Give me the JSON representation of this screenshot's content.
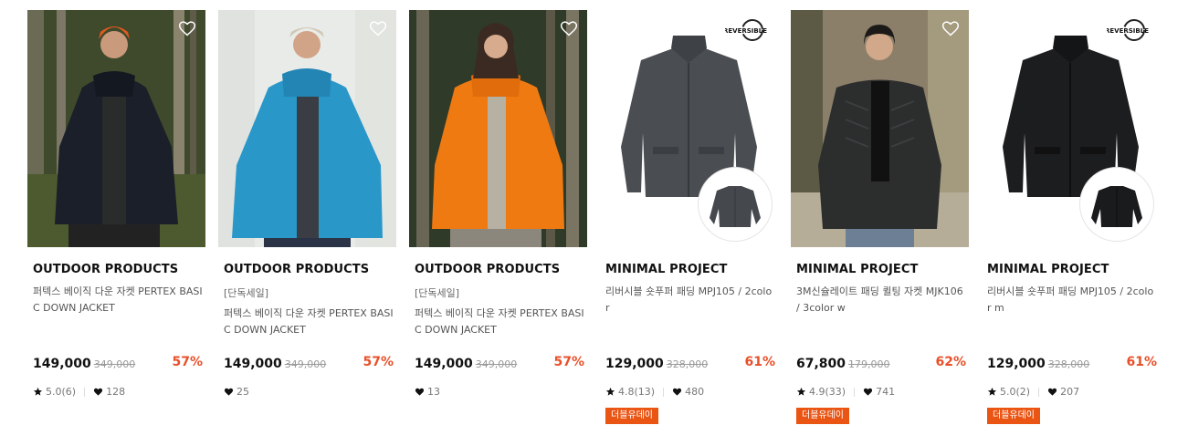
{
  "colors": {
    "discount": "#e8502a",
    "coupon_bg": "#ea5514"
  },
  "products": [
    {
      "brand": "OUTDOOR PRODUCTS",
      "tag": "",
      "name": "퍼텍스 베이직 다운 자켓 PERTEX BASIC DOWN JACKET",
      "price": "149,000",
      "original_price": "349,000",
      "discount": "57%",
      "rating": "5.0(6)",
      "likes": "128",
      "coupon": "",
      "image": "black-down-jacket-model",
      "reversible": ""
    },
    {
      "brand": "OUTDOOR PRODUCTS",
      "tag": "[단독세일]",
      "name": "퍼텍스 베이직 다운 자켓 PERTEX BASIC DOWN JACKET",
      "price": "149,000",
      "original_price": "349,000",
      "discount": "57%",
      "rating": "",
      "likes": "25",
      "coupon": "",
      "image": "blue-down-jacket-model",
      "reversible": ""
    },
    {
      "brand": "OUTDOOR PRODUCTS",
      "tag": "[단독세일]",
      "name": "퍼텍스 베이직 다운 자켓 PERTEX BASIC DOWN JACKET",
      "price": "149,000",
      "original_price": "349,000",
      "discount": "57%",
      "rating": "",
      "likes": "13",
      "coupon": "",
      "image": "orange-down-jacket-model",
      "reversible": ""
    },
    {
      "brand": "MINIMAL PROJECT",
      "tag": "",
      "name": "리버시블 숏푸퍼 패딩 MPJ105 / 2color",
      "price": "129,000",
      "original_price": "328,000",
      "discount": "61%",
      "rating": "4.8(13)",
      "likes": "480",
      "coupon": "더블유데이",
      "image": "gray-puffer-jacket",
      "reversible": "REVERSIBLE"
    },
    {
      "brand": "MINIMAL PROJECT",
      "tag": "",
      "name": "3M신슐레이트 패딩 퀼팅 자켓 MJK106 / 3color w",
      "price": "67,800",
      "original_price": "179,000",
      "discount": "62%",
      "rating": "4.9(33)",
      "likes": "741",
      "coupon": "더블유데이",
      "image": "quilted-jacket-model",
      "reversible": ""
    },
    {
      "brand": "MINIMAL PROJECT",
      "tag": "",
      "name": "리버시블 숏푸퍼 패딩 MPJ105 / 2color m",
      "price": "129,000",
      "original_price": "328,000",
      "discount": "61%",
      "rating": "5.0(2)",
      "likes": "207",
      "coupon": "더블유데이",
      "image": "black-puffer-jacket",
      "reversible": "REVERSIBLE"
    }
  ]
}
